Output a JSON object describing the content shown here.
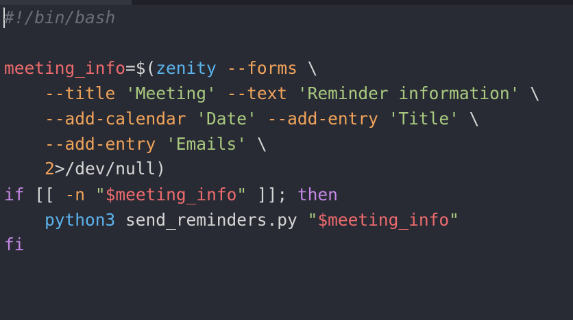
{
  "code": {
    "line1": {
      "comment": "#!/bin/bash"
    },
    "line3": {
      "var": "meeting_info",
      "assign": "=$(",
      "cmd": "zenity",
      "sp": " ",
      "opt": "--forms",
      "cont": " \\"
    },
    "line4": {
      "indent": "    ",
      "opt1": "--title",
      "s1": " ",
      "str1": "'Meeting'",
      "s2": " ",
      "opt2": "--text",
      "s3": " ",
      "str2": "'Reminder information'",
      "cont": " \\"
    },
    "line5": {
      "indent": "    ",
      "opt1": "--add-calendar",
      "s1": " ",
      "str1": "'Date'",
      "s2": " ",
      "opt2": "--add-entry",
      "s3": " ",
      "str2": "'Title'",
      "cont": " \\"
    },
    "line6": {
      "indent": "    ",
      "opt1": "--add-entry",
      "s1": " ",
      "str1": "'Emails'",
      "cont": " \\"
    },
    "line7": {
      "indent": "    ",
      "num": "2",
      "rest": ">/dev/null)"
    },
    "line8": {
      "kw1": "if",
      "p1": " [[ ",
      "opt": "-n",
      "s1": " ",
      "q1": "\"",
      "strvar": "$meeting_info",
      "q2": "\"",
      "p2": " ]]; ",
      "kw2": "then"
    },
    "line9": {
      "indent": "    ",
      "cmd": "python3",
      "s1": " ",
      "plain": "send_reminders.py",
      "s2": " ",
      "q1": "\"",
      "strvar": "$meeting_info",
      "q2": "\""
    },
    "line10": {
      "kw": "fi"
    }
  },
  "colors": {
    "background": "#292b34",
    "comment": "#6b6e78",
    "variable": "#ee6b6e",
    "command": "#5ab3ec",
    "option": "#f0a35a",
    "string": "#a8c97f",
    "keyword": "#c587e6",
    "text": "#d6d6d6"
  }
}
